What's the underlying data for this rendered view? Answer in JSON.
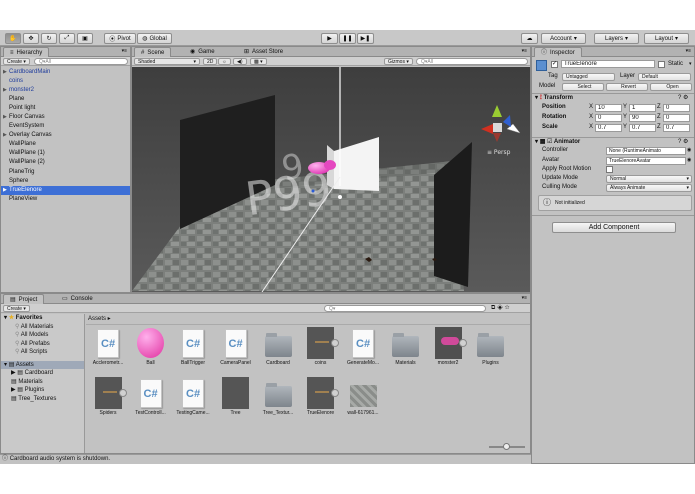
{
  "toolbar": {
    "pivot": "Pivot",
    "global": "Global",
    "account": "Account",
    "layers": "Layers",
    "layout": "Layout"
  },
  "hierarchy": {
    "tab": "Hierarchy",
    "create": "Create",
    "search": "Q▾All",
    "items": [
      {
        "label": "CardboardMain",
        "blue": true,
        "arrow": true
      },
      {
        "label": "coins",
        "blue": true,
        "arrow": false
      },
      {
        "label": "monster2",
        "blue": true,
        "arrow": true
      },
      {
        "label": "Plane",
        "blue": false,
        "arrow": false
      },
      {
        "label": "Point light",
        "blue": false,
        "arrow": false
      },
      {
        "label": "Floor Canvas",
        "blue": false,
        "arrow": true
      },
      {
        "label": "EventSystem",
        "blue": false,
        "arrow": false
      },
      {
        "label": "Overlay Canvas",
        "blue": false,
        "arrow": true
      },
      {
        "label": "WallPlane",
        "blue": false,
        "arrow": false
      },
      {
        "label": "WallPlane (1)",
        "blue": false,
        "arrow": false
      },
      {
        "label": "WallPlane (2)",
        "blue": false,
        "arrow": false
      },
      {
        "label": "PlaneTrig",
        "blue": false,
        "arrow": false
      },
      {
        "label": "Sphere",
        "blue": false,
        "arrow": false
      },
      {
        "label": "TrueElenore",
        "blue": false,
        "arrow": true,
        "selected": true
      },
      {
        "label": "PlaneView",
        "blue": false,
        "arrow": false
      }
    ]
  },
  "scene": {
    "tabs": [
      "Scene",
      "Game",
      "Asset Store"
    ],
    "shading": "Shaded",
    "mode2d": "2D",
    "gizmos": "Gizmos",
    "search": "Q▾All",
    "persp": "≡ Persp"
  },
  "inspector": {
    "tab": "Inspector",
    "name": "TrueElenore",
    "static": "Static",
    "tag_label": "Tag",
    "tag": "Untagged",
    "layer_label": "Layer",
    "layer": "Default",
    "model_label": "Model",
    "select": "Select",
    "revert": "Revert",
    "open": "Open",
    "transform": {
      "title": "Transform",
      "position": "Position",
      "rotation": "Rotation",
      "scale": "Scale",
      "x": "X",
      "y": "Y",
      "z": "Z",
      "pos": [
        "10",
        "1",
        "0"
      ],
      "rot": [
        "0",
        "90",
        "0"
      ],
      "scl": [
        "0.7",
        "0.7",
        "0.7"
      ]
    },
    "animator": {
      "title": "Animator",
      "controller_label": "Controller",
      "controller": "None (RuntimeAnimato",
      "avatar_label": "Avatar",
      "avatar": "TrueElenoreAvatar",
      "root_motion": "Apply Root Motion",
      "update_label": "Update Mode",
      "update": "Normal",
      "culling_label": "Culling Mode",
      "culling": "Always Animate",
      "note": "Not initialized"
    },
    "add_component": "Add Component"
  },
  "project": {
    "tabs": [
      "Project",
      "Console"
    ],
    "create": "Create",
    "favorites": {
      "title": "Favorites",
      "items": [
        "All Materials",
        "All Models",
        "All Prefabs",
        "All Scripts"
      ]
    },
    "assets_tree": {
      "title": "Assets",
      "items": [
        "Cardboard",
        "Materials",
        "Plugins",
        "Tree_Textures"
      ]
    },
    "breadcrumb": "Assets ▸",
    "assets": [
      {
        "label": "Acclerometr...",
        "kind": "script"
      },
      {
        "label": "Ball",
        "kind": "sphere"
      },
      {
        "label": "BallTrigger",
        "kind": "script"
      },
      {
        "label": "CameraPanel",
        "kind": "script"
      },
      {
        "label": "Cardboard",
        "kind": "folder"
      },
      {
        "label": "coins",
        "kind": "dark"
      },
      {
        "label": "GenerateMo...",
        "kind": "script"
      },
      {
        "label": "Materials",
        "kind": "folder"
      },
      {
        "label": "monster2",
        "kind": "monster"
      },
      {
        "label": "Plugins",
        "kind": "folder"
      },
      {
        "label": "Spiders",
        "kind": "dark"
      },
      {
        "label": "TestControll...",
        "kind": "script"
      },
      {
        "label": "TestingCame...",
        "kind": "script"
      },
      {
        "label": "Tree",
        "kind": "darkplain"
      },
      {
        "label": "Tree_Textur...",
        "kind": "folder"
      },
      {
        "label": "TrueElenore",
        "kind": "dark"
      },
      {
        "label": "wall-617961...",
        "kind": "stone"
      }
    ]
  },
  "status": "Cardboard audio system is shutdown.",
  "colors": {
    "selection": "#3d6fd6",
    "panel": "#c2c2c2",
    "link": "#1f3c9c"
  }
}
